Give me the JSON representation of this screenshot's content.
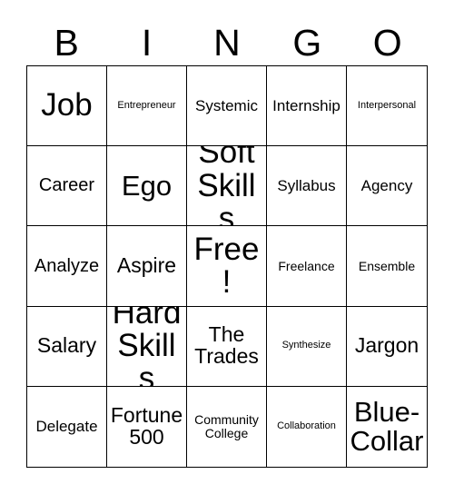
{
  "header": {
    "letters": [
      "B",
      "I",
      "N",
      "G",
      "O"
    ]
  },
  "grid": {
    "columns": 5,
    "rows": 5,
    "border_color": "#000000",
    "background_color": "#ffffff",
    "text_color": "#000000",
    "cells": [
      {
        "text": "Job",
        "size": "xxl"
      },
      {
        "text": "Entrepreneur",
        "size": "xs"
      },
      {
        "text": "Systemic",
        "size": "ms"
      },
      {
        "text": "Internship",
        "size": "ms"
      },
      {
        "text": "Interpersonal",
        "size": "xs"
      },
      {
        "text": "Career",
        "size": "m"
      },
      {
        "text": "Ego",
        "size": "xl"
      },
      {
        "text": "Soft Skills",
        "size": "xxl"
      },
      {
        "text": "Syllabus",
        "size": "ms"
      },
      {
        "text": "Agency",
        "size": "ms"
      },
      {
        "text": "Analyze",
        "size": "m"
      },
      {
        "text": "Aspire",
        "size": "ml"
      },
      {
        "text": "Free!",
        "size": "xxl"
      },
      {
        "text": "Freelance",
        "size": "s"
      },
      {
        "text": "Ensemble",
        "size": "s"
      },
      {
        "text": "Salary",
        "size": "ml"
      },
      {
        "text": "Hard Skills",
        "size": "xxl"
      },
      {
        "text": "The Trades",
        "size": "ml"
      },
      {
        "text": "Synthesize",
        "size": "xs"
      },
      {
        "text": "Jargon",
        "size": "ml"
      },
      {
        "text": "Delegate",
        "size": "ms"
      },
      {
        "text": "Fortune 500",
        "size": "ml"
      },
      {
        "text": "Community College",
        "size": "s"
      },
      {
        "text": "Collaboration",
        "size": "xs"
      },
      {
        "text": "Blue-Collar",
        "size": "xl"
      }
    ]
  }
}
